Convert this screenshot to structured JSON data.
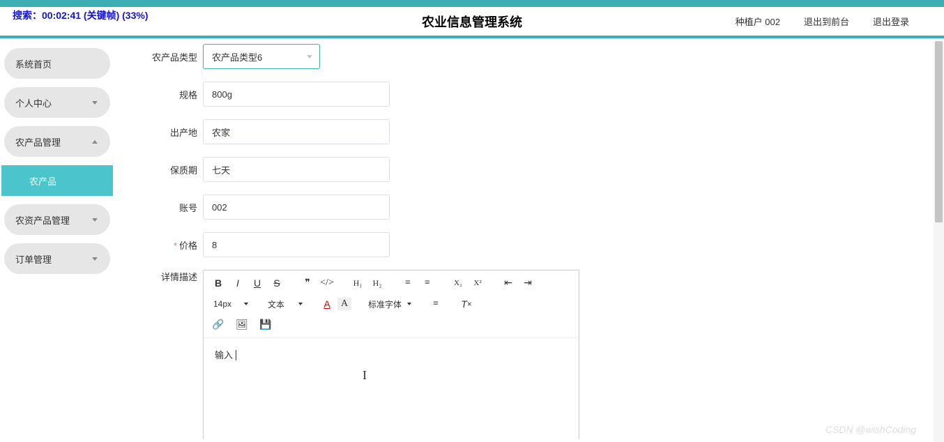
{
  "search_badge": "搜索：00:02:41 (关键帧) (33%)",
  "header": {
    "title": "农业信息管理系统",
    "user": "种植户 002",
    "exit_front": "退出到前台",
    "logout": "退出登录"
  },
  "sidebar": {
    "items": [
      {
        "label": "系统首页",
        "chevron": ""
      },
      {
        "label": "个人中心",
        "chevron": "down"
      },
      {
        "label": "农产品管理",
        "chevron": "up"
      },
      {
        "label": "农产品",
        "chevron": "",
        "active": true
      },
      {
        "label": "农资产品管理",
        "chevron": "down"
      },
      {
        "label": "订单管理",
        "chevron": "down"
      }
    ]
  },
  "form": {
    "product_type_label": "农产品类型",
    "product_type_value": "农产品类型6",
    "spec_label": "规格",
    "spec_value": "800g",
    "origin_label": "出产地",
    "origin_value": "农家",
    "shelf_life_label": "保质期",
    "shelf_life_value": "七天",
    "account_label": "账号",
    "account_value": "002",
    "price_label": "价格",
    "price_value": "8",
    "desc_label": "详情描述"
  },
  "editor": {
    "font_size": "14px",
    "format": "文本",
    "font_family": "标准字体",
    "content": "输入"
  },
  "watermark": "CSDN @wishCoding"
}
